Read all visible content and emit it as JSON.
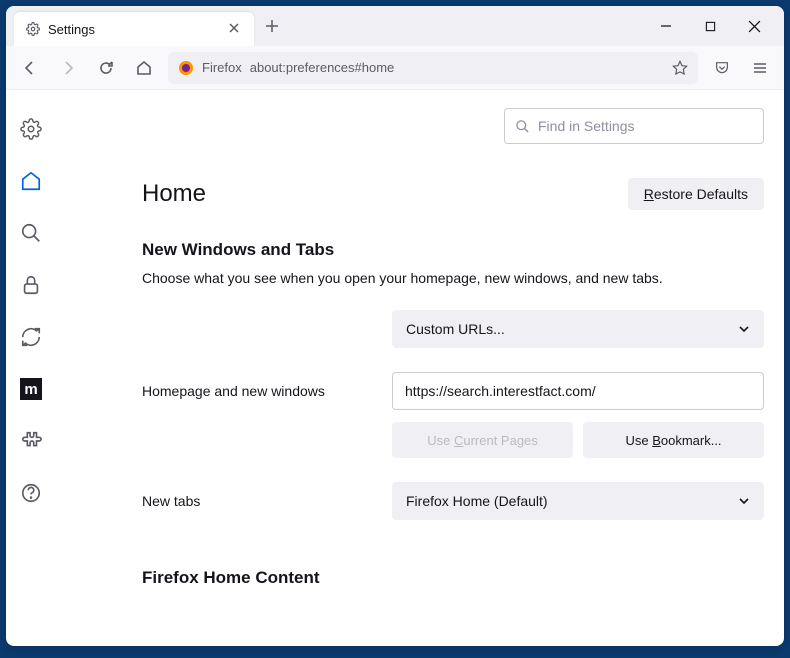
{
  "tab": {
    "title": "Settings"
  },
  "urlbar": {
    "identity": "Firefox",
    "url": "about:preferences#home"
  },
  "search": {
    "placeholder": "Find in Settings"
  },
  "page": {
    "title": "Home",
    "restore_label": "estore Defaults",
    "section_title": "New Windows and Tabs",
    "section_desc": "Choose what you see when you open your homepage, new windows, and new tabs."
  },
  "form": {
    "homepage_label": "Homepage and new windows",
    "homepage_select": "Custom URLs...",
    "homepage_url": "https://search.interestfact.com/",
    "use_current": "urrent Pages",
    "use_bookmark": "ookmark...",
    "newtabs_label": "New tabs",
    "newtabs_select": "Firefox Home (Default)"
  },
  "home_content": {
    "title": "Firefox Home Content"
  }
}
